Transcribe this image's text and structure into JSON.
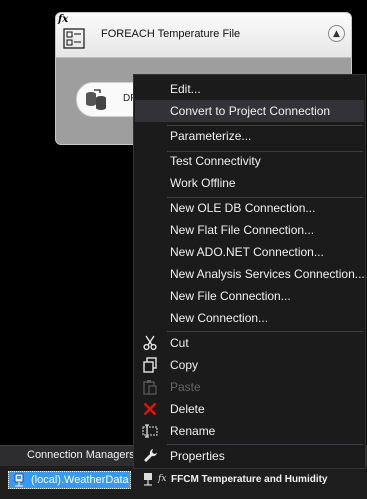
{
  "container": {
    "fx_badge": "fx",
    "title": "FOREACH Temperature File",
    "collapse_icon": "chevron-up-icon",
    "task_label": "DF"
  },
  "connection_managers": {
    "tab_label": "Connection Managers",
    "items": [
      {
        "label": "(local).WeatherData",
        "icon": "database-connection-icon",
        "selected": true
      },
      {
        "label": "FFCM Temperature and Humidity",
        "icon": "flat-file-connection-icon",
        "fx_badge": "fx",
        "selected": false
      }
    ]
  },
  "context_menu": {
    "items": [
      {
        "label": "Edit...",
        "icon": "",
        "disabled": false
      },
      {
        "label": "Convert to Project Connection",
        "icon": "",
        "disabled": false,
        "highlighted": true
      },
      {
        "label": "Parameterize...",
        "icon": "",
        "disabled": false
      },
      {
        "label": "Test Connectivity",
        "icon": "",
        "disabled": false
      },
      {
        "label": "Work Offline",
        "icon": "",
        "disabled": false
      },
      {
        "label": "New OLE DB Connection...",
        "icon": "",
        "disabled": false
      },
      {
        "label": "New Flat File Connection...",
        "icon": "",
        "disabled": false
      },
      {
        "label": "New ADO.NET Connection...",
        "icon": "",
        "disabled": false
      },
      {
        "label": "New Analysis Services Connection...",
        "icon": "",
        "disabled": false
      },
      {
        "label": "New File Connection...",
        "icon": "",
        "disabled": false
      },
      {
        "label": "New Connection...",
        "icon": "",
        "disabled": false
      },
      {
        "label": "Cut",
        "icon": "scissors-icon",
        "disabled": false
      },
      {
        "label": "Copy",
        "icon": "copy-icon",
        "disabled": false
      },
      {
        "label": "Paste",
        "icon": "paste-icon",
        "disabled": true
      },
      {
        "label": "Delete",
        "icon": "delete-x-icon",
        "disabled": false
      },
      {
        "label": "Rename",
        "icon": "rename-icon",
        "disabled": false
      },
      {
        "label": "Properties",
        "icon": "wrench-icon",
        "disabled": false
      }
    ]
  },
  "colors": {
    "menu_background": "#1b1b1c",
    "menu_highlight": "#333337",
    "selection_blue": "#3399ff",
    "delete_red": "#e51400"
  }
}
